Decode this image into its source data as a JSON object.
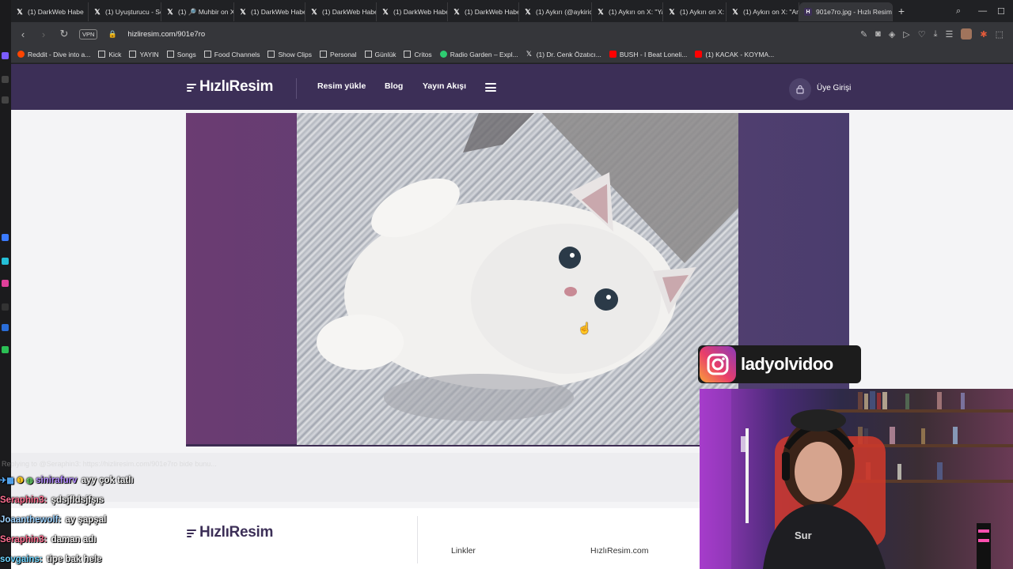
{
  "browser": {
    "tabs": [
      {
        "label": "(1) DarkWeb Habe",
        "icon": "x-logo-icon"
      },
      {
        "label": "(1) Uyuşturucu - Se",
        "icon": "x-logo-icon"
      },
      {
        "label": "(1) 🔎 Muhbir on X",
        "icon": "x-logo-icon"
      },
      {
        "label": "(1) DarkWeb Habe",
        "icon": "x-logo-icon"
      },
      {
        "label": "(1) DarkWeb Habe",
        "icon": "x-logo-icon"
      },
      {
        "label": "(1) DarkWeb Habe",
        "icon": "x-logo-icon"
      },
      {
        "label": "(1) DarkWeb Habe",
        "icon": "x-logo-icon"
      },
      {
        "label": "(1) Aykırı (@aykiric",
        "icon": "x-logo-icon"
      },
      {
        "label": "(1) Aykırı on X: \"Ya",
        "icon": "x-logo-icon"
      },
      {
        "label": "(1) Aykırı on X: \"M",
        "icon": "x-logo-icon"
      },
      {
        "label": "(1) Aykırı on X: \"Ar",
        "icon": "x-logo-icon"
      },
      {
        "label": "901e7ro.jpg - Hızlı Resim",
        "icon": "hizliresim-favicon-icon",
        "active": true
      }
    ],
    "url": "hizliresim.com/901e7ro",
    "vpn_label": "VPN",
    "bookmarks": [
      {
        "label": "Reddit - Dive into a...",
        "icon": "reddit-icon"
      },
      {
        "label": "Kick",
        "icon": "folder-icon"
      },
      {
        "label": "YAYIN",
        "icon": "folder-icon"
      },
      {
        "label": "Songs",
        "icon": "folder-icon"
      },
      {
        "label": "Food Channels",
        "icon": "folder-icon"
      },
      {
        "label": "Show Clips",
        "icon": "folder-icon"
      },
      {
        "label": "Personal",
        "icon": "folder-icon"
      },
      {
        "label": "Günlük",
        "icon": "folder-icon"
      },
      {
        "label": "Critos",
        "icon": "folder-icon"
      },
      {
        "label": "Radio Garden – Expl...",
        "icon": "radio-garden-icon"
      },
      {
        "label": "(1) Dr. Cenk Özatıcı...",
        "icon": "x-logo-icon"
      },
      {
        "label": "BUSH - I Beat Loneli...",
        "icon": "youtube-icon"
      },
      {
        "label": "(1) KACAK - KOYMA...",
        "icon": "youtube-icon"
      }
    ]
  },
  "site": {
    "logo": "HızlıResim",
    "nav": {
      "upload": "Resim yükle",
      "blog": "Blog",
      "feed": "Yayın Akışı",
      "login": "Üye Girişi"
    },
    "footer": {
      "logo": "HızlıResim",
      "links_heading": "Linkler",
      "site_heading": "HızlıResim.com"
    },
    "colors": {
      "nav_bg": "#3c2f57",
      "panel_bg": "#5b3f74"
    }
  },
  "overlay": {
    "instagram_handle": "ladyolvidoo",
    "chat": {
      "reply_hint": "Replying to @Seraphin3: https://hizliresim.com/901e7ro bide bunu...",
      "messages": [
        {
          "user": "sinirafurv",
          "text": "ayy çok tatlı",
          "user_color": "#b48cff"
        },
        {
          "user": "Seraphin3:",
          "text": "şdsjfldsjfşıs",
          "user_color": "#ff6f91"
        },
        {
          "user": "Joaanthewolf:",
          "text": "ay şapşal",
          "user_color": "#9fd4ff"
        },
        {
          "user": "Seraphin3:",
          "text": "daman adı",
          "user_color": "#ff6f91"
        },
        {
          "user": "sovgains:",
          "text": "tipe bak hele",
          "user_color": "#6fd6ff"
        }
      ]
    }
  }
}
